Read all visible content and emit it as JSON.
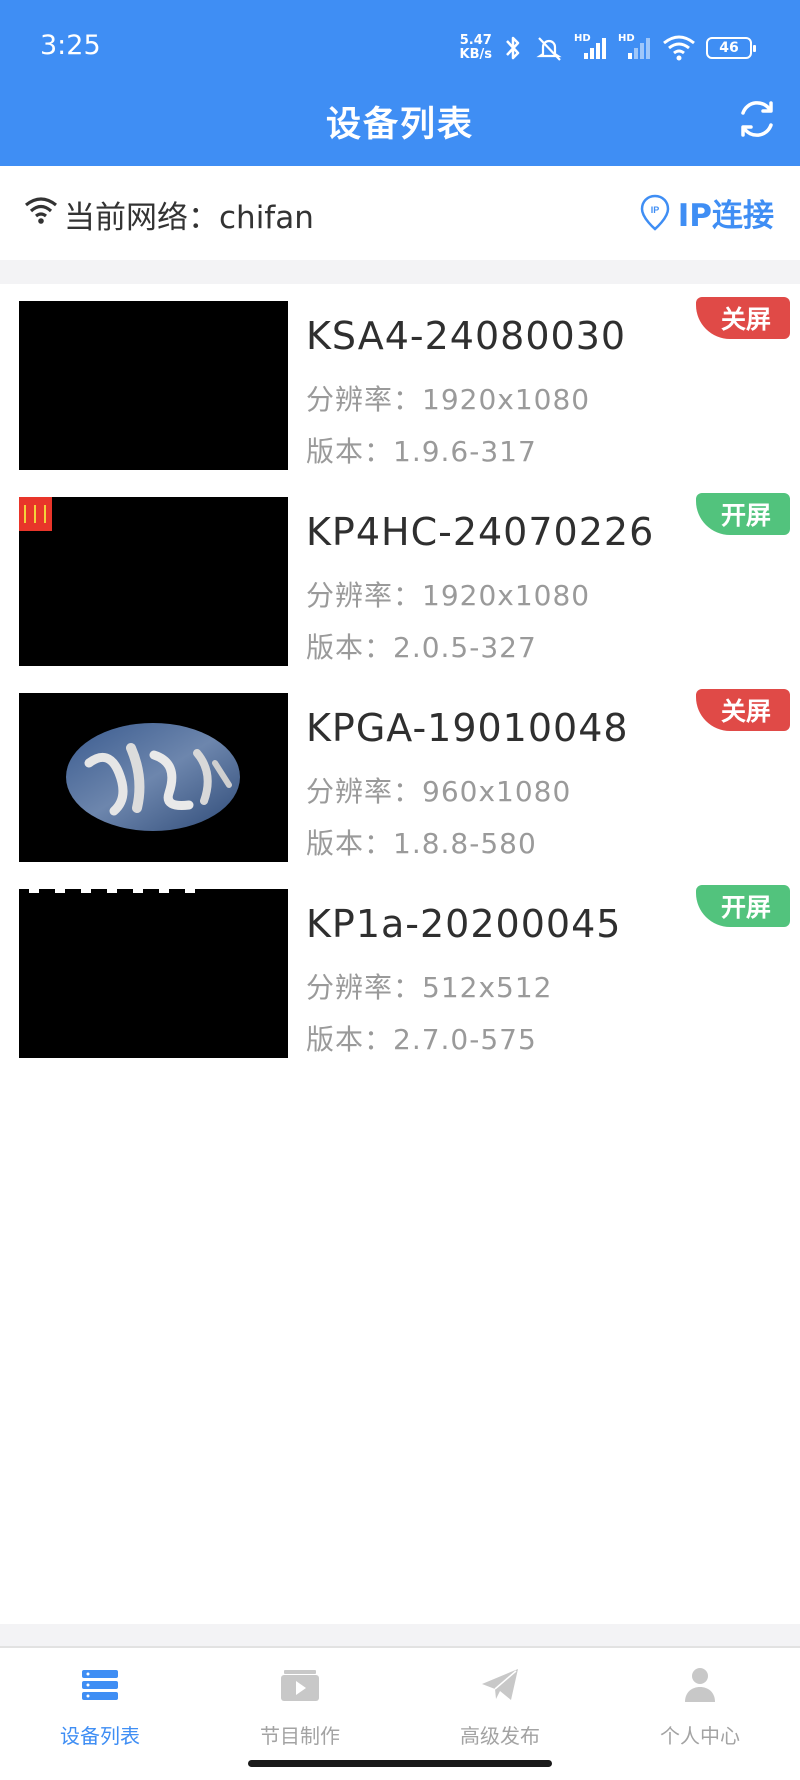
{
  "status": {
    "time": "3:25",
    "net_speed_value": "5.47",
    "net_speed_unit": "KB/s",
    "hd1": "HD",
    "hd2": "HD",
    "battery": "46"
  },
  "header": {
    "title": "设备列表",
    "refresh_icon": "refresh-icon"
  },
  "network": {
    "label": "当前网络：chifan",
    "ip_connect": "IP连接",
    "ip_icon_text": "IP"
  },
  "devices": [
    {
      "name": "KSA4-24080030",
      "resolution": "分辨率：1920x1080",
      "version": "版本：1.9.6-317",
      "screen_status": "关屏",
      "status_color": "#e04a47"
    },
    {
      "name": "KP4HC-24070226",
      "resolution": "分辨率：1920x1080",
      "version": "版本：2.0.5-327",
      "screen_status": "开屏",
      "status_color": "#52c37d"
    },
    {
      "name": "KPGA-19010048",
      "resolution": "分辨率：960x1080",
      "version": "版本：1.8.8-580",
      "screen_status": "关屏",
      "status_color": "#e04a47"
    },
    {
      "name": "KP1a-20200045",
      "resolution": "分辨率：512x512",
      "version": "版本：2.7.0-575",
      "screen_status": "开屏",
      "status_color": "#52c37d"
    }
  ],
  "tabs": [
    {
      "label": "设备列表",
      "icon": "device-list-icon",
      "active": true
    },
    {
      "label": "节目制作",
      "icon": "program-play-icon",
      "active": false
    },
    {
      "label": "高级发布",
      "icon": "paper-plane-icon",
      "active": false
    },
    {
      "label": "个人中心",
      "icon": "person-icon",
      "active": false
    }
  ],
  "colors": {
    "primary": "#3f8ef4",
    "off": "#e04a47",
    "on": "#52c37d"
  }
}
